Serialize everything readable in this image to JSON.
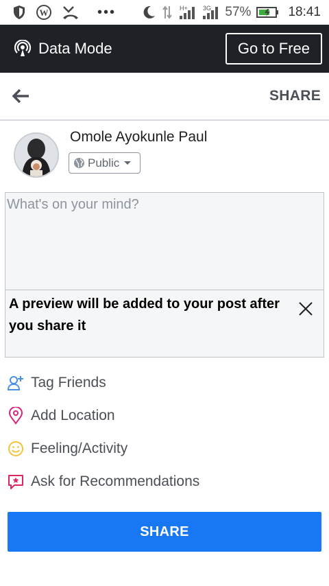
{
  "status_bar": {
    "network_type": "H+",
    "network_type_2": "3G",
    "battery_percent": "57%",
    "time": "18:41",
    "icons": [
      "shield-icon",
      "wordpress-icon",
      "missed-call-icon",
      "more-dots-icon",
      "moon-icon",
      "data-arrows-icon",
      "signal-icon",
      "signal-icon",
      "battery-icon"
    ]
  },
  "data_mode": {
    "label": "Data Mode",
    "button_label": "Go to Free",
    "icon": "broadcast-icon"
  },
  "header": {
    "back_icon": "arrow-left-icon",
    "share_label": "SHARE"
  },
  "user": {
    "name": "Omole Ayokunle Paul",
    "privacy_label": "Public",
    "privacy_icon": "globe-icon"
  },
  "composer": {
    "placeholder": "What's on your mind?"
  },
  "preview": {
    "text": "A preview will be added to your post after you share it",
    "close_icon": "close-icon"
  },
  "actions": [
    {
      "label": "Tag Friends",
      "icon": "tag-friends-icon",
      "color": "#4a90e2"
    },
    {
      "label": "Add Location",
      "icon": "location-pin-icon",
      "color": "#d6257a"
    },
    {
      "label": "Feeling/Activity",
      "icon": "smiley-icon",
      "color": "#f5c33b"
    },
    {
      "label": "Ask for Recommendations",
      "icon": "recommendation-icon",
      "color": "#e0245e"
    }
  ],
  "share_button": {
    "label": "SHARE"
  },
  "colors": {
    "brand_blue": "#1877f2",
    "data_bar_bg": "#1e2126"
  }
}
